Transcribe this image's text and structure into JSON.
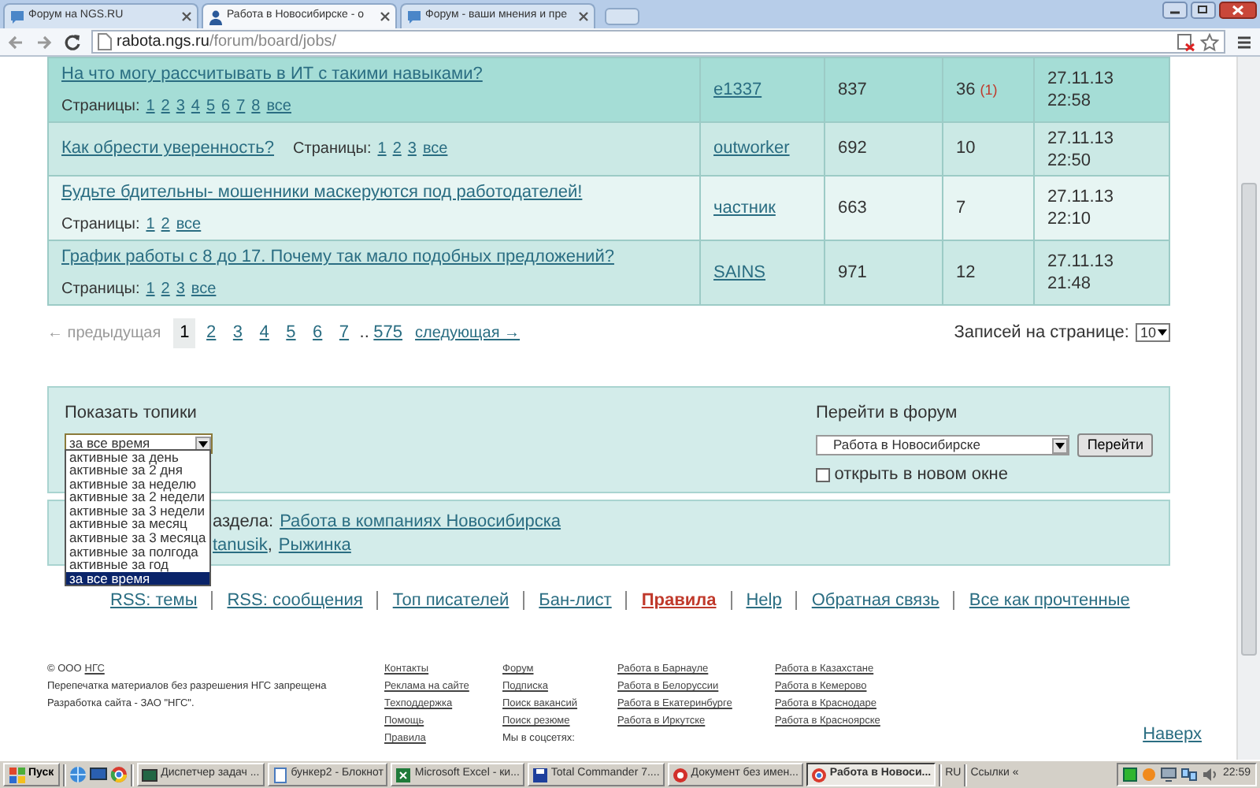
{
  "browser": {
    "tabs": [
      {
        "title": "Форум на NGS.RU",
        "selected": false
      },
      {
        "title": "Работа в Новосибирске - о",
        "selected": true
      },
      {
        "title": "Форум - ваши мнения и пре",
        "selected": false
      }
    ],
    "address": {
      "host": "rabota.ngs.ru",
      "path": "/forum/board/jobs/"
    }
  },
  "topics": [
    {
      "title": "На что могу рассчитывать в ИТ с такими навыками?",
      "pages_label": "Страницы:",
      "pages": [
        "1",
        "2",
        "3",
        "4",
        "5",
        "6",
        "7",
        "8",
        "все"
      ],
      "pages_inline": false,
      "author": "e1337",
      "views": "837",
      "replies": "36",
      "new_replies": "(1)",
      "date": "27.11.13",
      "time": "22:58",
      "hovered": true
    },
    {
      "title": "Как обрести уверенность?",
      "pages_label": "Страницы:",
      "pages": [
        "1",
        "2",
        "3",
        "все"
      ],
      "pages_inline": true,
      "author": "outworker",
      "views": "692",
      "replies": "10",
      "date": "27.11.13",
      "time": "22:50",
      "hovered": false
    },
    {
      "title": "Будьте бдительны- мошенники маскеруются под работодателей!",
      "pages_label": "Страницы:",
      "pages": [
        "1",
        "2",
        "все"
      ],
      "pages_inline": false,
      "author": "частник",
      "views": "663",
      "replies": "7",
      "date": "27.11.13",
      "time": "22:10",
      "hovered": false
    },
    {
      "title": "График работы с 8 до 17. Почему так мало подобных предложений?",
      "pages_label": "Страницы:",
      "pages": [
        "1",
        "2",
        "3",
        "все"
      ],
      "pages_inline": false,
      "author": "SAINS",
      "views": "971",
      "replies": "12",
      "date": "27.11.13",
      "time": "21:48",
      "hovered": false
    }
  ],
  "pagination": {
    "previous": {
      "label": "← предыдущая",
      "disabled": true
    },
    "pages": [
      {
        "label": "1",
        "selected": true
      },
      {
        "label": "2",
        "selected": false
      },
      {
        "label": "3",
        "selected": false
      },
      {
        "label": "4",
        "selected": false
      },
      {
        "label": "5",
        "selected": false
      },
      {
        "label": "6",
        "selected": false
      },
      {
        "label": "7",
        "selected": false
      }
    ],
    "ellipsis": "..",
    "last": "575",
    "next": {
      "label": "следующая →",
      "disabled": false
    },
    "per_page_label": "Записей на странице:",
    "per_page": "10"
  },
  "filter": {
    "label": "Показать топики",
    "value": "за все время",
    "options": [
      {
        "label": "активные за день",
        "selected": false
      },
      {
        "label": "активные за 2 дня",
        "selected": false
      },
      {
        "label": "активные за неделю",
        "selected": false
      },
      {
        "label": "активные за 2 недели",
        "selected": false
      },
      {
        "label": "активные за 3 недели",
        "selected": false
      },
      {
        "label": "активные за месяц",
        "selected": false
      },
      {
        "label": "активные за 3 месяца",
        "selected": false
      },
      {
        "label": "активные за полгода",
        "selected": false
      },
      {
        "label": "активные за год",
        "selected": false
      },
      {
        "label": "за все время",
        "selected": true
      }
    ]
  },
  "jump": {
    "label": "Перейти в форум",
    "value": "Работа в Новосибирске",
    "button": "Перейти",
    "new_window": {
      "label": "открыть в новом окне",
      "checked": false
    }
  },
  "info": {
    "prefix": "аздела:",
    "section_link": "Работа в компаниях Новосибирска",
    "separator": ",",
    "moderators": [
      "tanusik",
      "Рыжинка"
    ]
  },
  "footer_links": [
    {
      "label": "RSS: темы",
      "emphasized": false
    },
    {
      "label": "RSS: сообщения",
      "emphasized": false
    },
    {
      "label": "Топ писателей",
      "emphasized": false
    },
    {
      "label": "Бан-лист",
      "emphasized": false
    },
    {
      "label": "Правила",
      "emphasized": true
    },
    {
      "label": "Help",
      "emphasized": false
    },
    {
      "label": "Обратная связь",
      "emphasized": false
    },
    {
      "label": "Все как прочтенные",
      "emphasized": false
    }
  ],
  "site_footer": {
    "copyright": "© ООО",
    "copyright_link": "НГС",
    "notice": "Перепечатка материалов без разрешения НГС запрещена",
    "developer": "Разработка сайта - ЗАО \"НГС\".",
    "columns": [
      [
        {
          "label": "Контакты",
          "kind": "link"
        },
        {
          "label": "Реклама на сайте",
          "kind": "link"
        },
        {
          "label": "Техподдержка",
          "kind": "link"
        },
        {
          "label": "Помощь",
          "kind": "link"
        },
        {
          "label": "Правила",
          "kind": "link"
        }
      ],
      [
        {
          "label": "Форум",
          "kind": "link"
        },
        {
          "label": "Подписка",
          "kind": "link"
        },
        {
          "label": "Поиск вакансий",
          "kind": "link"
        },
        {
          "label": "Поиск резюме",
          "kind": "link"
        },
        {
          "label": "Мы в соцсетях:",
          "kind": "text"
        }
      ],
      [
        {
          "label": "Работа в Барнауле",
          "kind": "link"
        },
        {
          "label": "Работа в Белоруссии",
          "kind": "link"
        },
        {
          "label": "Работа в Екатеринбурге",
          "kind": "link"
        },
        {
          "label": "Работа в Иркутске",
          "kind": "link"
        }
      ],
      [
        {
          "label": "Работа в Казахстане",
          "kind": "link"
        },
        {
          "label": "Работа в Кемерово",
          "kind": "link"
        },
        {
          "label": "Работа в Краснодаре",
          "kind": "link"
        },
        {
          "label": "Работа в Красноярске",
          "kind": "link"
        }
      ]
    ],
    "top_link": "Наверх"
  },
  "taskbar": {
    "start": "Пуск",
    "tasks": [
      {
        "title": "Диспетчер задач ...",
        "selected": false
      },
      {
        "title": "бункер2 - Блокнот",
        "selected": false
      },
      {
        "title": "Microsoft Excel - ки...",
        "selected": false
      },
      {
        "title": "Total Commander 7....",
        "selected": false
      },
      {
        "title": "Документ без имен...",
        "selected": false
      },
      {
        "title": "Работа в Новоси...",
        "selected": true
      }
    ],
    "language": "RU",
    "links": "Ссылки",
    "chevron": "«",
    "clock": "22:59"
  }
}
